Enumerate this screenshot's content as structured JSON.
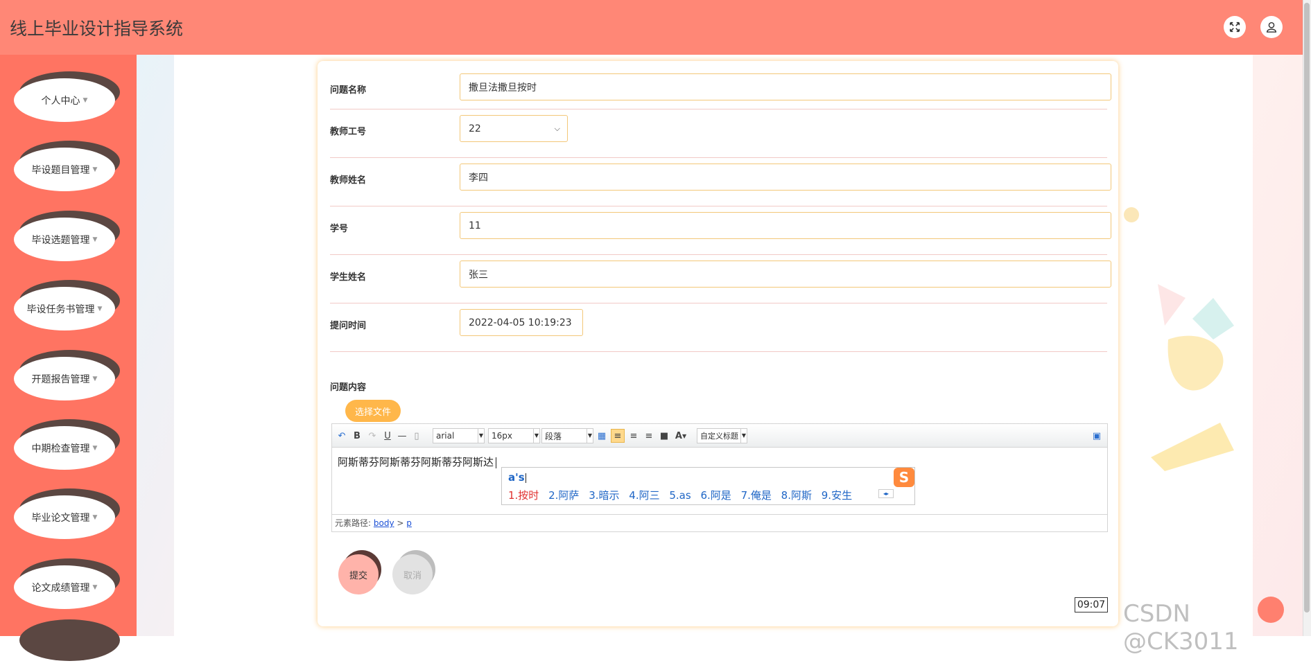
{
  "app": {
    "title": "线上毕业设计指导系统"
  },
  "sidebar": {
    "items": [
      {
        "label": "个人中心"
      },
      {
        "label": "毕设题目管理"
      },
      {
        "label": "毕设选题管理"
      },
      {
        "label": "毕设任务书管理"
      },
      {
        "label": "开题报告管理"
      },
      {
        "label": "中期检查管理"
      },
      {
        "label": "毕业论文管理"
      },
      {
        "label": "论文成绩管理"
      }
    ]
  },
  "form": {
    "question_name": {
      "label": "问题名称",
      "value": "撒旦法撒旦按时"
    },
    "teacher_id": {
      "label": "教师工号",
      "value": "22"
    },
    "teacher_name": {
      "label": "教师姓名",
      "value": "李四"
    },
    "student_id": {
      "label": "学号",
      "value": "11"
    },
    "student_name": {
      "label": "学生姓名",
      "value": "张三"
    },
    "ask_time": {
      "label": "提问时间",
      "value": "2022-04-05 10:19:23"
    },
    "content": {
      "label": "问题内容"
    }
  },
  "editor": {
    "upload_label": "选择文件",
    "font_family": "arial",
    "font_size": "16px",
    "paragraph": "段落",
    "custom_title": "自定义标题",
    "text": "阿斯蒂芬阿斯蒂芬阿斯蒂芬阿斯达",
    "path_label": "元素路径:",
    "path_body": "body",
    "path_sep": ">",
    "path_p": "p"
  },
  "ime": {
    "input": "a's",
    "candidates": [
      "1.按时",
      "2.阿萨",
      "3.暗示",
      "4.阿三",
      "5.as",
      "6.阿是",
      "7.俺是",
      "8.阿斯",
      "9.安生"
    ],
    "logo": "S"
  },
  "actions": {
    "submit": "提交",
    "cancel": "取消"
  },
  "overlay": {
    "time": "09:07",
    "watermark": "CSDN @CK3011"
  },
  "colors": {
    "header": "#ff8776",
    "sidebar": "#ff7462",
    "input_border": "#f3c778",
    "upload_button": "#ffb74a"
  }
}
